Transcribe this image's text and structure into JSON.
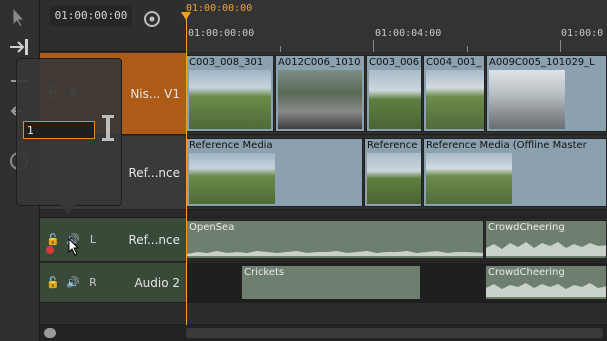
{
  "timecode": "01:00:00:00",
  "ruler": {
    "playhead_timecode": "01:00:00:00",
    "ticks": [
      "01:00:00:00",
      "01:00:04:00",
      "01:00:0"
    ]
  },
  "tracks": [
    {
      "name": "Nis... V1",
      "kind": "video"
    },
    {
      "name": "Ref...nce",
      "kind": "reference"
    },
    {
      "name": "Ref...nce",
      "kind": "audio",
      "channel": "L"
    },
    {
      "name": "Audio 2",
      "kind": "audio",
      "channel": "R"
    }
  ],
  "video_clips": [
    {
      "label": "C003_008_301"
    },
    {
      "label": "A012C006_1010"
    },
    {
      "label": "C003_006"
    },
    {
      "label": "C004_001_"
    },
    {
      "label": "A009C005_101029_L"
    }
  ],
  "reference_clips": [
    {
      "label": "Reference Media"
    },
    {
      "label": "Reference"
    },
    {
      "label": "Reference Media (Offline Master"
    }
  ],
  "audio1_clips": [
    {
      "label": "OpenSea"
    },
    {
      "label": "CrowdCheering"
    }
  ],
  "audio2_clips": [
    {
      "label": "Crickets"
    },
    {
      "label": "CrowdCheering"
    }
  ],
  "popup": {
    "height_value": "1"
  },
  "icons": {
    "select": "arrow-select-icon",
    "track_insert": "track-insert-icon",
    "snap": "snap-magnet-icon",
    "lock": "lock-icon",
    "speaker": "speaker-icon",
    "record": "record-icon"
  },
  "colors": {
    "playhead": "#f0a030",
    "video_header": "#ad5b16",
    "audio_header": "#394a39",
    "video_clip": "#8ba1b0",
    "audio_clip": "#6f7f6f"
  }
}
